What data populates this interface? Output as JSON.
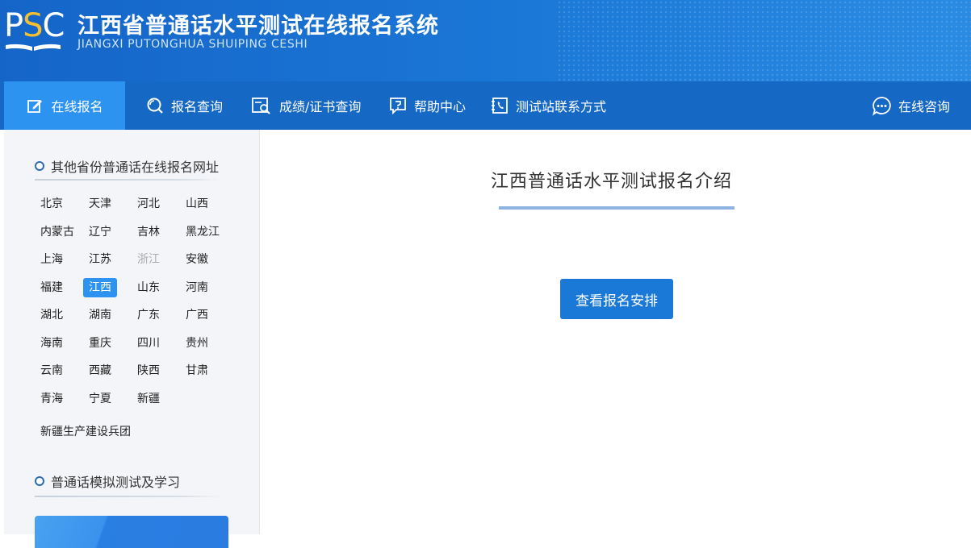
{
  "header": {
    "logo_text": "PSC",
    "title": "江西省普通话水平测试在线报名系统",
    "subtitle": "JIANGXI PUTONGHUA SHUIPING CESHI"
  },
  "nav": {
    "items": [
      {
        "label": "在线报名",
        "icon": "edit-icon"
      },
      {
        "label": "报名查询",
        "icon": "search-icon"
      },
      {
        "label": "成绩/证书查询",
        "icon": "certificate-search-icon"
      },
      {
        "label": "帮助中心",
        "icon": "help-icon"
      },
      {
        "label": "测试站联系方式",
        "icon": "phone-book-icon"
      }
    ],
    "consult": {
      "label": "在线咨询",
      "icon": "chat-icon"
    }
  },
  "sidebar": {
    "provinces_title": "其他省份普通话在线报名网址",
    "provinces": [
      [
        "北京",
        "天津",
        "河北",
        "山西"
      ],
      [
        "内蒙古",
        "辽宁",
        "吉林",
        "黑龙江"
      ],
      [
        "上海",
        "江苏",
        "浙江",
        "安徽"
      ],
      [
        "福建",
        "江西",
        "山东",
        "河南"
      ],
      [
        "湖北",
        "湖南",
        "广东",
        "广西"
      ],
      [
        "海南",
        "重庆",
        "四川",
        "贵州"
      ],
      [
        "云南",
        "西藏",
        "陕西",
        "甘肃"
      ],
      [
        "青海",
        "宁夏",
        "新疆"
      ]
    ],
    "selected_province": "江西",
    "disabled_province": "浙江",
    "extra_item": "新疆生产建设兵团",
    "study_title": "普通话模拟测试及学习"
  },
  "main": {
    "title": "江西普通话水平测试报名介绍",
    "button_label": "查看报名安排"
  },
  "colors": {
    "nav_bg": "#1668c5",
    "nav_active": "#2d93f0",
    "button": "#1a78d6",
    "logo_accent": "#f5c030"
  }
}
